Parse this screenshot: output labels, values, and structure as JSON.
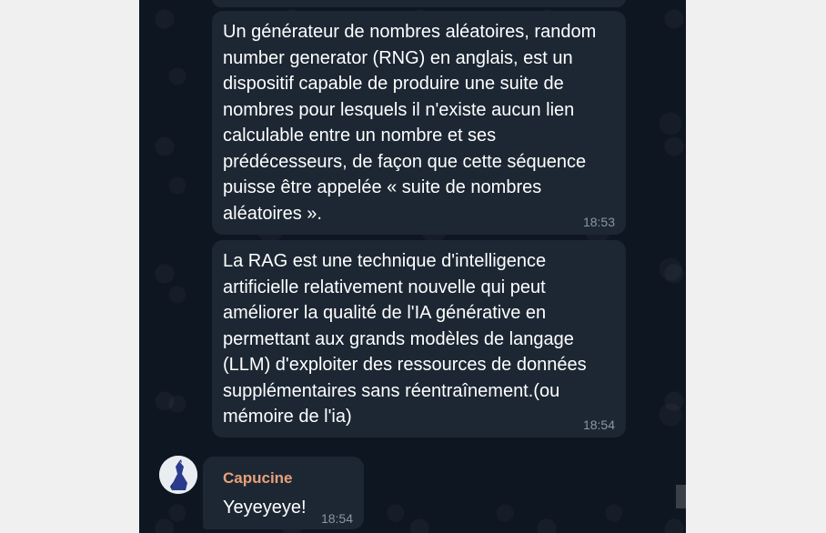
{
  "messages": [
    {
      "text": "Un générateur de nombres aléatoires, random number generator (RNG) en anglais, est un dispositif capable de produire une suite de nombres pour lesquels il n'existe aucun lien calculable entre un nombre et ses prédécesseurs, de façon que cette séquence puisse être appelée « suite de nombres aléatoires ».",
      "time": "18:53"
    },
    {
      "text": "La RAG est une technique d'intelligence artificielle relativement nouvelle qui peut améliorer la qualité de l'IA générative en permettant aux grands modèles de langage (LLM) d'exploiter des ressources de données supplémentaires sans réentraînement.(ou mémoire de l'ia)",
      "time": "18:54"
    },
    {
      "sender": "Capucine",
      "text": "Yeyeyeye!",
      "time": "18:54"
    }
  ],
  "colors": {
    "chat_background": "#0e1621",
    "bubble": "#1c2733",
    "sender_name": "#e8a07a",
    "timestamp": "#8a96a3"
  },
  "icons": {
    "avatar": "user-avatar-icon"
  }
}
